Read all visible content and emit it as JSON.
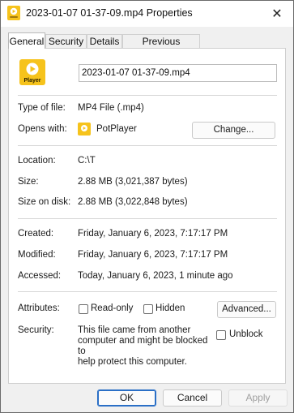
{
  "window": {
    "title": "2023-01-07 01-37-09.mp4 Properties",
    "close_glyph": "✕"
  },
  "tabs": [
    {
      "label": "General",
      "active": true
    },
    {
      "label": "Security"
    },
    {
      "label": "Details"
    },
    {
      "label": "Previous Versions"
    }
  ],
  "file_icon": {
    "name": "potplayer-icon",
    "label": "Player",
    "color": "#f6c31c"
  },
  "filename": "2023-01-07 01-37-09.mp4",
  "type_of_file": {
    "label": "Type of file:",
    "value": "MP4 File (.mp4)"
  },
  "opens_with": {
    "label": "Opens with:",
    "value": "PotPlayer",
    "change_label": "Change..."
  },
  "location": {
    "label": "Location:",
    "value": "C:\\T"
  },
  "size": {
    "label": "Size:",
    "value": "2.88 MB (3,021,387 bytes)"
  },
  "size_on_disk": {
    "label": "Size on disk:",
    "value": "2.88 MB (3,022,848 bytes)"
  },
  "created": {
    "label": "Created:",
    "value": "Friday, January 6, 2023, 7:17:17 PM"
  },
  "modified": {
    "label": "Modified:",
    "value": "Friday, January 6, 2023, 7:17:17 PM"
  },
  "accessed": {
    "label": "Accessed:",
    "value": "Today, January 6, 2023, 1 minute ago"
  },
  "attributes": {
    "label": "Attributes:",
    "readonly_label": "Read-only",
    "readonly_checked": false,
    "hidden_label": "Hidden",
    "hidden_checked": false,
    "advanced_label": "Advanced..."
  },
  "security": {
    "label": "Security:",
    "message_lines": [
      "This file came from another",
      "computer and might be blocked to",
      "help protect this computer."
    ],
    "unblock_label": "Unblock",
    "unblock_checked": false
  },
  "buttons": {
    "ok": "OK",
    "cancel": "Cancel",
    "apply": "Apply"
  }
}
